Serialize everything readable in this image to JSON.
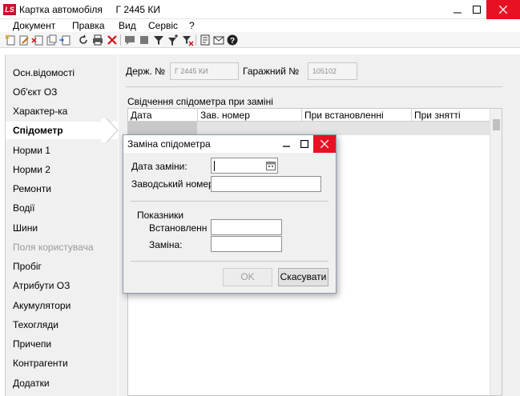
{
  "window": {
    "logo_text": "LS",
    "title": "Картка автомобіля     Г 2445 КИ"
  },
  "menu": [
    "Документ",
    "Правка",
    "Вид",
    "Сервіс",
    "?"
  ],
  "sidebar": {
    "items": [
      {
        "label": "Осн.відомості"
      },
      {
        "label": "Об'єкт ОЗ"
      },
      {
        "label": "Характер-ка"
      },
      {
        "label": "Спідометр",
        "active": true
      },
      {
        "label": "Норми 1"
      },
      {
        "label": "Норми 2"
      },
      {
        "label": "Ремонти"
      },
      {
        "label": "Водії"
      },
      {
        "label": "Шини"
      },
      {
        "label": "Поля користувача",
        "disabled": true
      },
      {
        "label": "Пробіг"
      },
      {
        "label": "Атрибути ОЗ"
      },
      {
        "label": "Акумулятори"
      },
      {
        "label": "Техогляди"
      },
      {
        "label": "Причепи"
      },
      {
        "label": "Контрагенти"
      },
      {
        "label": "Додатки"
      }
    ]
  },
  "header": {
    "state_no_label": "Держ. №",
    "state_no_value": "Г 2445 КИ",
    "garage_no_label": "Гаражний №",
    "garage_no_value": "105102"
  },
  "table": {
    "title": "Свідчення спідометра при заміні",
    "columns": [
      "Дата",
      "Зав. номер",
      "При встановленні",
      "При знятті"
    ]
  },
  "dialog": {
    "title": "Заміна спідометра",
    "date_label": "Дата заміни:",
    "date_value": "",
    "serial_label": "Заводський номер",
    "serial_value": "",
    "indicators_title": "Показники",
    "installed_label": "Встановлення",
    "installed_value": "",
    "replacement_label": "Заміна:",
    "replacement_value": "",
    "ok_label": "OK",
    "cancel_label": "Скасувати"
  },
  "colors": {
    "close_red": "#e81123",
    "logo_red": "#c8102e"
  }
}
